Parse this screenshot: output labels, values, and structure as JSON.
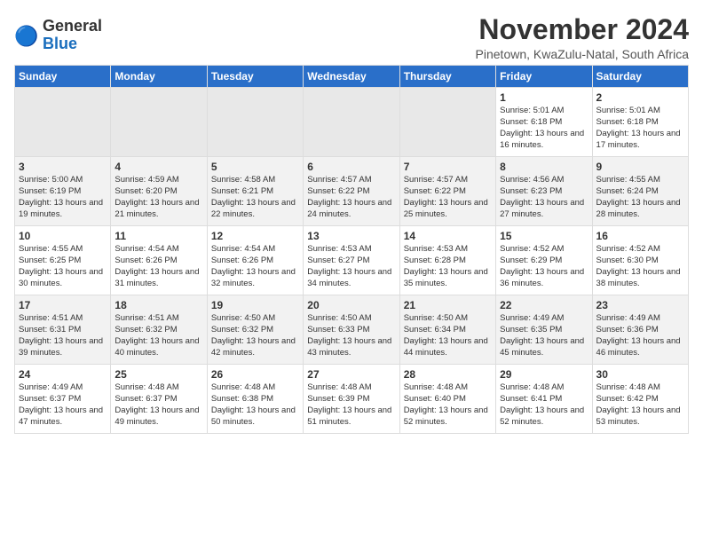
{
  "logo": {
    "text_general": "General",
    "text_blue": "Blue"
  },
  "title": "November 2024",
  "location": "Pinetown, KwaZulu-Natal, South Africa",
  "headers": [
    "Sunday",
    "Monday",
    "Tuesday",
    "Wednesday",
    "Thursday",
    "Friday",
    "Saturday"
  ],
  "weeks": [
    [
      {
        "day": "",
        "content": ""
      },
      {
        "day": "",
        "content": ""
      },
      {
        "day": "",
        "content": ""
      },
      {
        "day": "",
        "content": ""
      },
      {
        "day": "",
        "content": ""
      },
      {
        "day": "1",
        "content": "Sunrise: 5:01 AM\nSunset: 6:18 PM\nDaylight: 13 hours and 16 minutes."
      },
      {
        "day": "2",
        "content": "Sunrise: 5:01 AM\nSunset: 6:18 PM\nDaylight: 13 hours and 17 minutes."
      }
    ],
    [
      {
        "day": "3",
        "content": "Sunrise: 5:00 AM\nSunset: 6:19 PM\nDaylight: 13 hours and 19 minutes."
      },
      {
        "day": "4",
        "content": "Sunrise: 4:59 AM\nSunset: 6:20 PM\nDaylight: 13 hours and 21 minutes."
      },
      {
        "day": "5",
        "content": "Sunrise: 4:58 AM\nSunset: 6:21 PM\nDaylight: 13 hours and 22 minutes."
      },
      {
        "day": "6",
        "content": "Sunrise: 4:57 AM\nSunset: 6:22 PM\nDaylight: 13 hours and 24 minutes."
      },
      {
        "day": "7",
        "content": "Sunrise: 4:57 AM\nSunset: 6:22 PM\nDaylight: 13 hours and 25 minutes."
      },
      {
        "day": "8",
        "content": "Sunrise: 4:56 AM\nSunset: 6:23 PM\nDaylight: 13 hours and 27 minutes."
      },
      {
        "day": "9",
        "content": "Sunrise: 4:55 AM\nSunset: 6:24 PM\nDaylight: 13 hours and 28 minutes."
      }
    ],
    [
      {
        "day": "10",
        "content": "Sunrise: 4:55 AM\nSunset: 6:25 PM\nDaylight: 13 hours and 30 minutes."
      },
      {
        "day": "11",
        "content": "Sunrise: 4:54 AM\nSunset: 6:26 PM\nDaylight: 13 hours and 31 minutes."
      },
      {
        "day": "12",
        "content": "Sunrise: 4:54 AM\nSunset: 6:26 PM\nDaylight: 13 hours and 32 minutes."
      },
      {
        "day": "13",
        "content": "Sunrise: 4:53 AM\nSunset: 6:27 PM\nDaylight: 13 hours and 34 minutes."
      },
      {
        "day": "14",
        "content": "Sunrise: 4:53 AM\nSunset: 6:28 PM\nDaylight: 13 hours and 35 minutes."
      },
      {
        "day": "15",
        "content": "Sunrise: 4:52 AM\nSunset: 6:29 PM\nDaylight: 13 hours and 36 minutes."
      },
      {
        "day": "16",
        "content": "Sunrise: 4:52 AM\nSunset: 6:30 PM\nDaylight: 13 hours and 38 minutes."
      }
    ],
    [
      {
        "day": "17",
        "content": "Sunrise: 4:51 AM\nSunset: 6:31 PM\nDaylight: 13 hours and 39 minutes."
      },
      {
        "day": "18",
        "content": "Sunrise: 4:51 AM\nSunset: 6:32 PM\nDaylight: 13 hours and 40 minutes."
      },
      {
        "day": "19",
        "content": "Sunrise: 4:50 AM\nSunset: 6:32 PM\nDaylight: 13 hours and 42 minutes."
      },
      {
        "day": "20",
        "content": "Sunrise: 4:50 AM\nSunset: 6:33 PM\nDaylight: 13 hours and 43 minutes."
      },
      {
        "day": "21",
        "content": "Sunrise: 4:50 AM\nSunset: 6:34 PM\nDaylight: 13 hours and 44 minutes."
      },
      {
        "day": "22",
        "content": "Sunrise: 4:49 AM\nSunset: 6:35 PM\nDaylight: 13 hours and 45 minutes."
      },
      {
        "day": "23",
        "content": "Sunrise: 4:49 AM\nSunset: 6:36 PM\nDaylight: 13 hours and 46 minutes."
      }
    ],
    [
      {
        "day": "24",
        "content": "Sunrise: 4:49 AM\nSunset: 6:37 PM\nDaylight: 13 hours and 47 minutes."
      },
      {
        "day": "25",
        "content": "Sunrise: 4:48 AM\nSunset: 6:37 PM\nDaylight: 13 hours and 49 minutes."
      },
      {
        "day": "26",
        "content": "Sunrise: 4:48 AM\nSunset: 6:38 PM\nDaylight: 13 hours and 50 minutes."
      },
      {
        "day": "27",
        "content": "Sunrise: 4:48 AM\nSunset: 6:39 PM\nDaylight: 13 hours and 51 minutes."
      },
      {
        "day": "28",
        "content": "Sunrise: 4:48 AM\nSunset: 6:40 PM\nDaylight: 13 hours and 52 minutes."
      },
      {
        "day": "29",
        "content": "Sunrise: 4:48 AM\nSunset: 6:41 PM\nDaylight: 13 hours and 52 minutes."
      },
      {
        "day": "30",
        "content": "Sunrise: 4:48 AM\nSunset: 6:42 PM\nDaylight: 13 hours and 53 minutes."
      }
    ]
  ]
}
